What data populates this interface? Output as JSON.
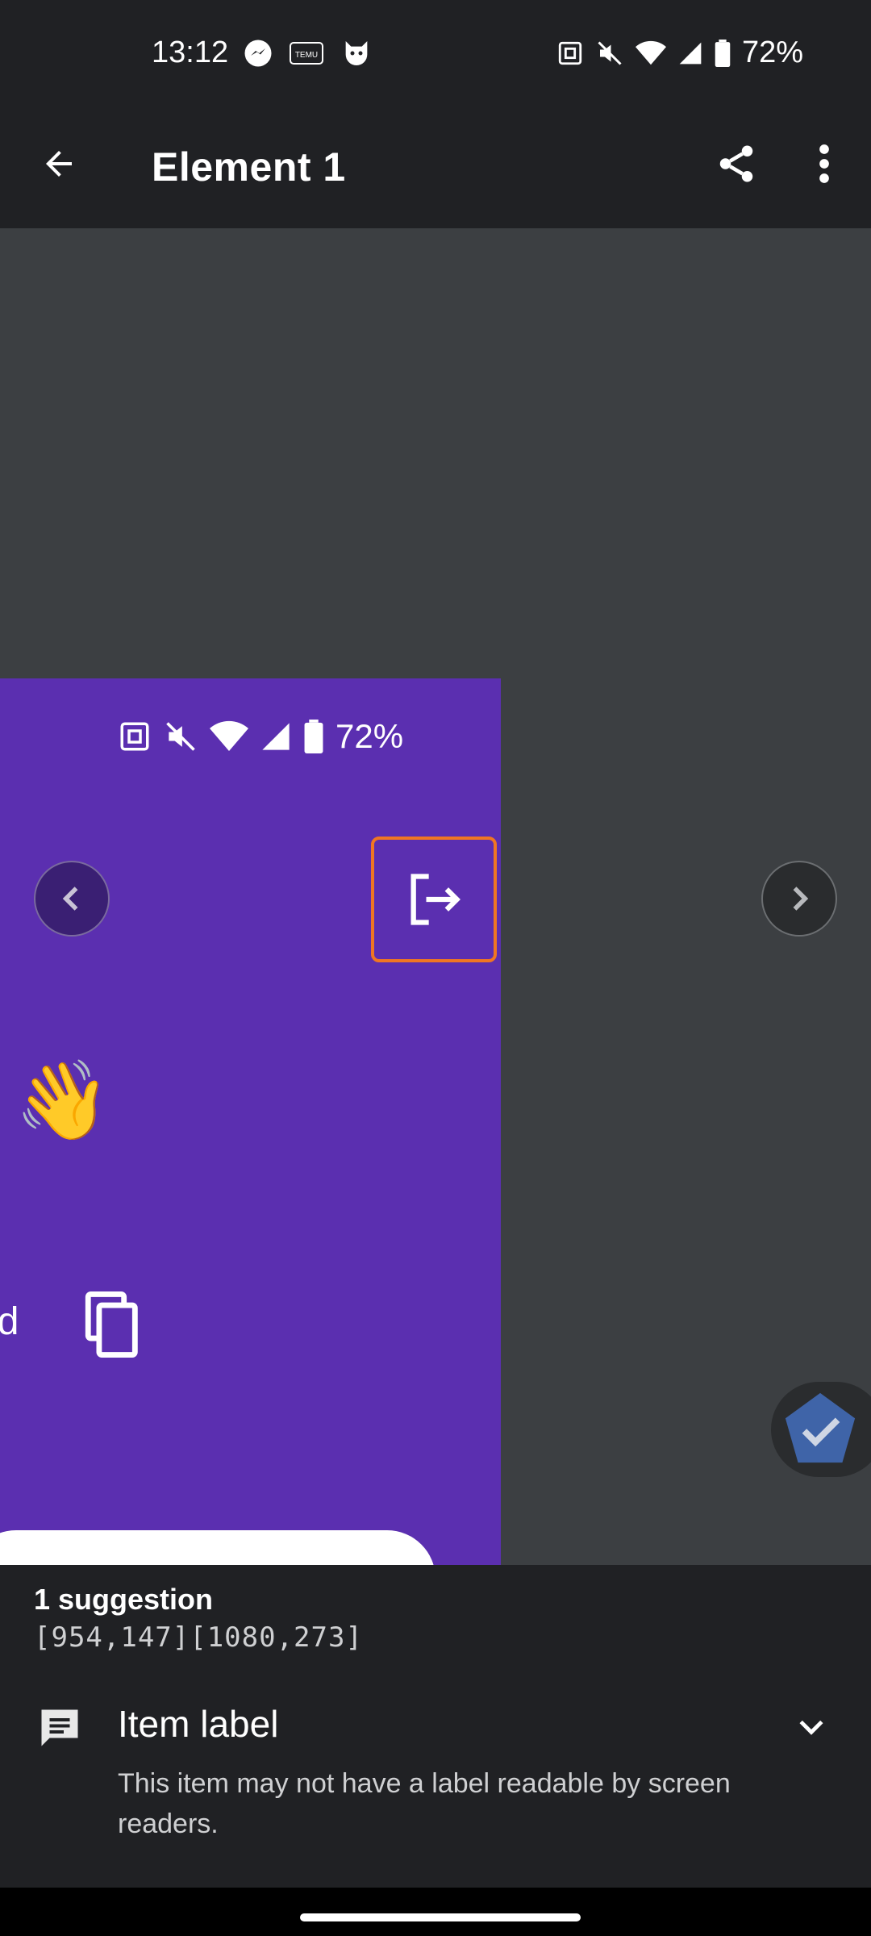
{
  "status_bar": {
    "time": "13:12",
    "battery": "72%",
    "left_icons": [
      "messenger-icon",
      "temu-icon",
      "app-cat-icon"
    ],
    "right_icons": [
      "nfc-icon",
      "mute-icon",
      "wifi-icon",
      "signal-icon",
      "battery-icon"
    ]
  },
  "toolbar": {
    "title": "Element 1",
    "back_icon": "arrow-back-icon",
    "share_icon": "share-icon",
    "more_icon": "more-vert-icon"
  },
  "preview": {
    "phone_battery": "72%",
    "partial_text": "ud",
    "emoji": "👋",
    "highlight_color": "#f07622",
    "phone_bg_color": "#5b2fb0"
  },
  "suggestions": {
    "count_label": "1 suggestion",
    "coords": "[954,147][1080,273]",
    "item_title": "Item label",
    "item_description": "This item may not have a label readable by screen readers."
  }
}
